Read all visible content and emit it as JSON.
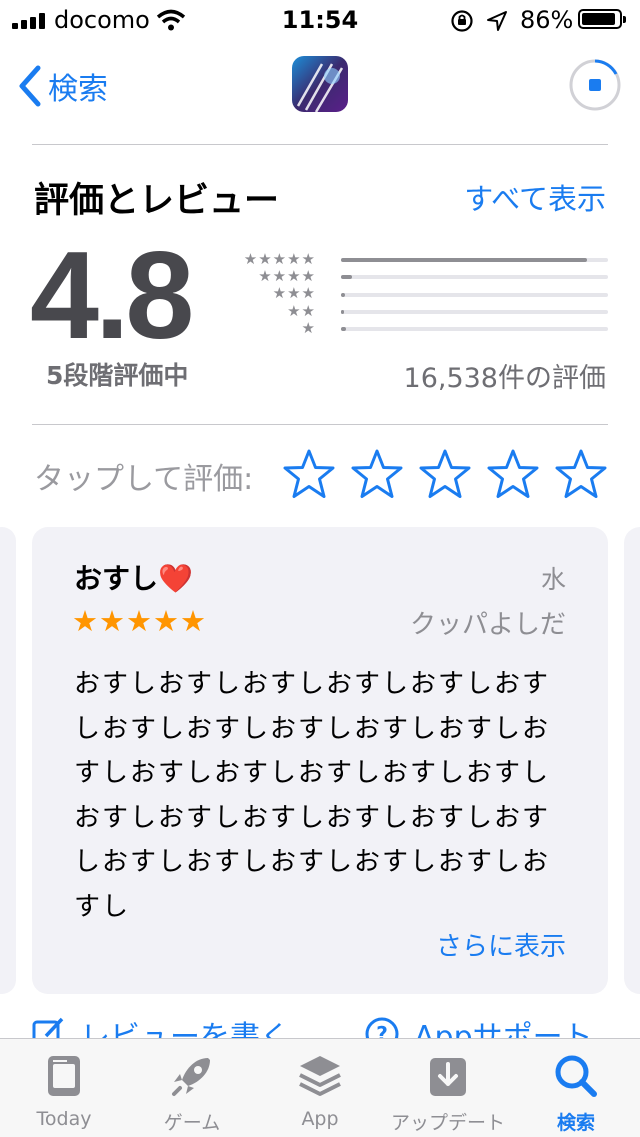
{
  "status_bar": {
    "carrier": "docomo",
    "time": "11:54",
    "battery": "86%"
  },
  "nav": {
    "back_label": "検索"
  },
  "ratings": {
    "title": "評価とレビュー",
    "see_all": "すべて表示",
    "average": "4.8",
    "out_of": "5段階評価中",
    "count": "16,538件の評価",
    "distribution": [
      {
        "stars": "★★★★★",
        "fraction": 0.92
      },
      {
        "stars": "★★★★",
        "fraction": 0.04
      },
      {
        "stars": "★★★",
        "fraction": 0.015
      },
      {
        "stars": "★★",
        "fraction": 0.01
      },
      {
        "stars": "★",
        "fraction": 0.02
      }
    ]
  },
  "tap_to_rate": {
    "label": "タップして評価:"
  },
  "review": {
    "title": "おすし❤️",
    "stars": "★★★★★",
    "date": "水",
    "author": "クッパよしだ",
    "body": "おすしおすしおすしおすしおすしおすしおすしおすしおすしおすしおすしおすしおすしおすしおすしおすしおすしおすしおすしおすしおすしおすしおすしおすしおすしおすしおすしおすしおすし",
    "more": "さらに表示"
  },
  "actions": {
    "write_review": "レビューを書く",
    "app_support": "Appサポート"
  },
  "tabs": [
    {
      "label": "Today",
      "icon": "today-icon"
    },
    {
      "label": "ゲーム",
      "icon": "rocket-icon"
    },
    {
      "label": "App",
      "icon": "layers-icon"
    },
    {
      "label": "アップデート",
      "icon": "download-icon"
    },
    {
      "label": "検索",
      "icon": "search-icon"
    }
  ],
  "colors": {
    "accent": "#1a7cf0",
    "star": "#ff9500",
    "gray": "#8e8e93"
  }
}
